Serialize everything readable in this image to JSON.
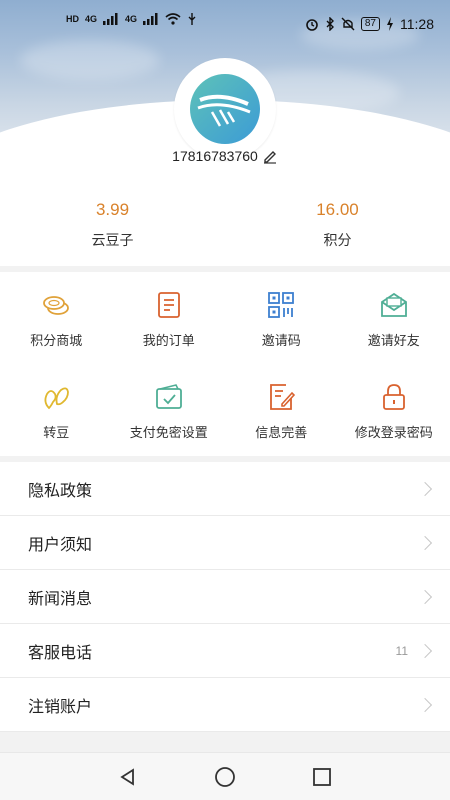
{
  "status_bar": {
    "left_indicators": [
      "HD",
      "HD",
      "4G",
      "4G"
    ],
    "battery": "87",
    "time": "11:28"
  },
  "profile": {
    "phone": "17816783760",
    "edit_icon": "pencil-icon"
  },
  "points": [
    {
      "value": "3.99",
      "label": "云豆子"
    },
    {
      "value": "16.00",
      "label": "积分"
    }
  ],
  "features": [
    {
      "label": "积分商城",
      "icon": "coins-icon",
      "color": "#e0a23a"
    },
    {
      "label": "我的订单",
      "icon": "order-list-icon",
      "color": "#d9622f"
    },
    {
      "label": "邀请码",
      "icon": "qr-code-icon",
      "color": "#3d7fd0"
    },
    {
      "label": "邀请好友",
      "icon": "envelope-icon",
      "color": "#4fae95"
    },
    {
      "label": "转豆",
      "icon": "bean-icon",
      "color": "#e0b830"
    },
    {
      "label": "支付免密设置",
      "icon": "wallet-check-icon",
      "color": "#4fae95"
    },
    {
      "label": "信息完善",
      "icon": "document-edit-icon",
      "color": "#d9622f"
    },
    {
      "label": "修改登录密码",
      "icon": "lock-icon",
      "color": "#d9622f"
    }
  ],
  "menu": [
    {
      "label": "隐私政策",
      "extra": ""
    },
    {
      "label": "用户须知",
      "extra": ""
    },
    {
      "label": "新闻消息",
      "extra": ""
    },
    {
      "label": "客服电话",
      "extra": "11"
    },
    {
      "label": "注销账户",
      "extra": ""
    }
  ],
  "colors": {
    "accent": "#d9822b"
  }
}
